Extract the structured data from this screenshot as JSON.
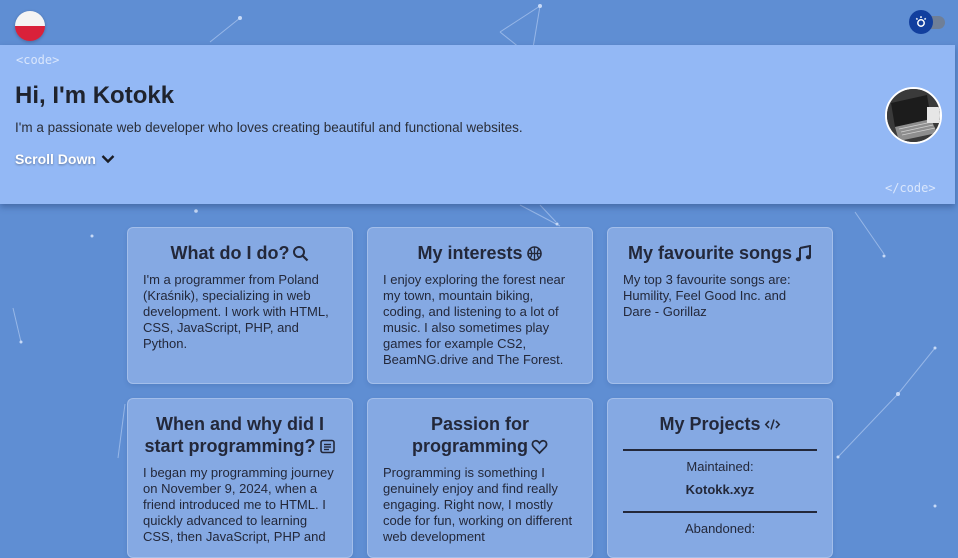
{
  "header": {
    "language": "Polish",
    "theme_toggle_icon": "sun-icon"
  },
  "hero": {
    "code_open": "<code>",
    "title": "Hi, I'm Kotokk",
    "subtitle": "I'm a passionate web developer who loves creating beautiful and functional websites.",
    "scroll_label": "Scroll Down",
    "code_close": "</code>"
  },
  "cards": [
    {
      "title": "What do I do?",
      "icon": "search-icon",
      "text": "I'm a programmer from Poland (Kraśnik), specializing in web development. I work with HTML, CSS, JavaScript, PHP, and Python."
    },
    {
      "title": "My interests",
      "icon": "basketball-icon",
      "text": "I enjoy exploring the forest near my town, mountain biking, coding, and listening to a lot of music. I also sometimes play games for example CS2, BeamNG.drive and The Forest."
    },
    {
      "title": "My favourite songs",
      "icon": "music-note-icon",
      "text": "My top 3 favourite songs are: Humility, Feel Good Inc. and Dare - Gorillaz"
    },
    {
      "title_line1": "When and why did I",
      "title_line2": "start programming?",
      "icon": "article-icon",
      "text": "I began my programming journey on November 9, 2024, when a friend introduced me to HTML. I quickly advanced to learning CSS, then JavaScript, PHP and"
    },
    {
      "title_line1": "Passion for",
      "title_line2": "programming",
      "icon": "heart-icon",
      "text": "Programming is something I genuinely enjoy and find really engaging. Right now, I mostly code for fun, working on different web development"
    },
    {
      "title": "My Projects",
      "icon": "code-icon",
      "maintained_label": "Maintained:",
      "maintained_project": "Kotokk.xyz",
      "abandoned_label": "Abandoned:"
    }
  ],
  "colors": {
    "background": "#5f8ed3",
    "hero": "#93b8f5",
    "card": "#85a9e3",
    "toggle_knob": "#123f9e",
    "flag_red": "#d9213a"
  }
}
